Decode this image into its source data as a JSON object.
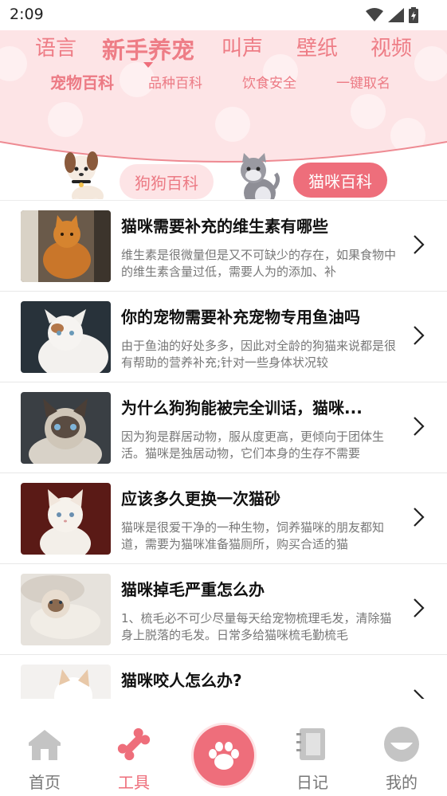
{
  "status_bar": {
    "time": "2:09",
    "icons": [
      "wifi-icon",
      "signal-icon",
      "battery-icon"
    ]
  },
  "top_tabs": [
    {
      "label": "语言",
      "active": false
    },
    {
      "label": "新手养宠",
      "active": true
    },
    {
      "label": "叫声",
      "active": false
    },
    {
      "label": "壁纸",
      "active": false
    },
    {
      "label": "视频",
      "active": false
    }
  ],
  "sub_tabs": [
    {
      "label": "宠物百科",
      "active": true
    },
    {
      "label": "品种百科",
      "active": false
    },
    {
      "label": "饮食安全",
      "active": false
    },
    {
      "label": "一键取名",
      "active": false
    }
  ],
  "pet_switch": {
    "dog_label": "狗狗百科",
    "cat_label": "猫咪百科",
    "selected": "cat"
  },
  "articles": [
    {
      "title": "猫咪需要补充的维生素有哪些",
      "desc": "维生素是很微量但是又不可缺少的存在，如果食物中的维生素含量过低，需要人为的添加、补",
      "thumb": "orange-cat-photo"
    },
    {
      "title": "你的宠物需要补充宠物专用鱼油吗",
      "desc": "由于鱼油的好处多多，因此对全龄的狗猫来说都是很有帮助的营养补充;针对一些身体状况较",
      "thumb": "white-kitten-photo"
    },
    {
      "title": "为什么狗狗能被完全训话，猫咪...",
      "desc": "因为狗是群居动物，服从度更高，更倾向于团体生活。猫咪是独居动物，它们本身的生存不需要",
      "thumb": "ragdoll-cat-photo"
    },
    {
      "title": "应该多久更换一次猫砂",
      "desc": "猫咪是很爱干净的一种生物，饲养猫咪的朋友都知道，需要为猫咪准备猫厕所，购买合适的猫",
      "thumb": "kitten-on-red-photo"
    },
    {
      "title": "猫咪掉毛严重怎么办",
      "desc": "1、梳毛必不可少尽量每天给宠物梳理毛发，清除猫身上脱落的毛发。日常多给猫咪梳毛勤梳毛",
      "thumb": "persian-cat-photo"
    },
    {
      "title": "猫咪咬人怎么办?",
      "desc": "",
      "thumb": "white-cat-photo"
    }
  ],
  "bottom_nav": [
    {
      "label": "首页",
      "icon": "home-icon",
      "active": false
    },
    {
      "label": "工具",
      "icon": "bone-icon",
      "active": true
    },
    {
      "label": "",
      "icon": "paw-icon",
      "active": false
    },
    {
      "label": "日记",
      "icon": "notebook-icon",
      "active": false
    },
    {
      "label": "我的",
      "icon": "profile-icon",
      "active": false
    }
  ],
  "colors": {
    "accent": "#ee6e7b",
    "header_bg": "#fde4e6",
    "tab_text": "#ec7a84"
  }
}
